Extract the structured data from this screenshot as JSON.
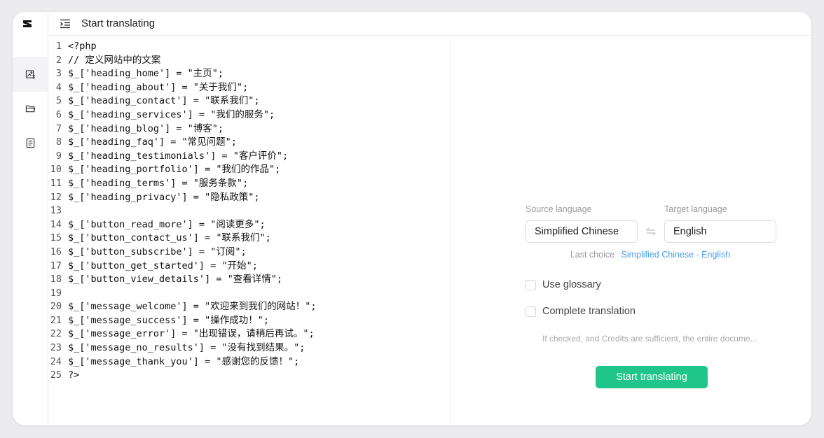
{
  "header": {
    "title": "Start translating"
  },
  "code_lines": [
    "<?php",
    "// 定义网站中的文案",
    "$_['heading_home'] = \"主页\";",
    "$_['heading_about'] = \"关于我们\";",
    "$_['heading_contact'] = \"联系我们\";",
    "$_['heading_services'] = \"我们的服务\";",
    "$_['heading_blog'] = \"博客\";",
    "$_['heading_faq'] = \"常见问题\";",
    "$_['heading_testimonials'] = \"客户评价\";",
    "$_['heading_portfolio'] = \"我们的作品\";",
    "$_['heading_terms'] = \"服务条款\";",
    "$_['heading_privacy'] = \"隐私政策\";",
    "",
    "$_['button_read_more'] = \"阅读更多\";",
    "$_['button_contact_us'] = \"联系我们\";",
    "$_['button_subscribe'] = \"订阅\";",
    "$_['button_get_started'] = \"开始\";",
    "$_['button_view_details'] = \"查看详情\";",
    "",
    "$_['message_welcome'] = \"欢迎来到我们的网站！\";",
    "$_['message_success'] = \"操作成功！\";",
    "$_['message_error'] = \"出现错误，请稍后再试。\";",
    "$_['message_no_results'] = \"没有找到结果。\";",
    "$_['message_thank_you'] = \"感谢您的反馈！\";",
    "?>"
  ],
  "translation": {
    "source_label": "Source language",
    "target_label": "Target language",
    "source_value": "Simplified Chinese",
    "target_value": "English",
    "last_choice_label": "Last choice",
    "last_choice_value": "Simplified Chinese - English",
    "use_glossary_label": "Use glossary",
    "complete_translation_label": "Complete translation",
    "complete_translation_hint": "If checked, and Credits are sufficient, the entire docume...",
    "start_button": "Start translating"
  },
  "colors": {
    "accent_green": "#1fc58a",
    "link_blue": "#4a9ee8"
  },
  "icons": {
    "logo": "app-logo-icon",
    "menu": "menu-toggle-icon",
    "rail": [
      "image-translate-icon",
      "folder-icon",
      "document-icon"
    ],
    "swap": "swap-arrows-icon"
  }
}
